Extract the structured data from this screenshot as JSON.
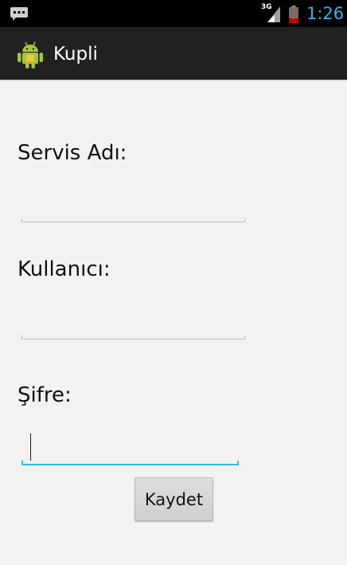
{
  "status_bar": {
    "left_icon": "notification-message-icon",
    "network_label": "3G",
    "network_icon": "cell-signal-icon",
    "battery_icon": "battery-low-icon",
    "time": "1:26",
    "time_color": "#33b5e5"
  },
  "action_bar": {
    "app_icon": "android-robot-icon",
    "title": "Kupli"
  },
  "form": {
    "service_label": "Servis Adı:",
    "service_value": "",
    "user_label": "Kullanıcı:",
    "user_value": "",
    "password_label": "Şifre:",
    "password_value": "",
    "save_label": "Kaydet"
  },
  "colors": {
    "accent": "#33b5e5",
    "action_bar_bg": "#212121",
    "background": "#f2f2f2"
  }
}
